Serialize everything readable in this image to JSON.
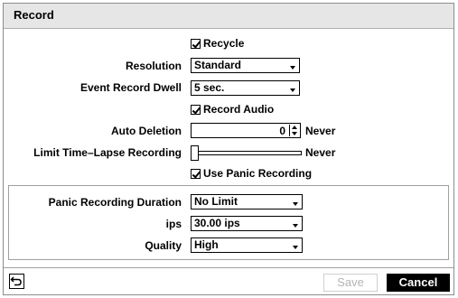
{
  "title": "Record",
  "recycle": {
    "label": "Recycle",
    "checked": true
  },
  "resolution": {
    "label": "Resolution",
    "value": "Standard"
  },
  "event_record_dwell": {
    "label": "Event Record Dwell",
    "value": "5 sec."
  },
  "record_audio": {
    "label": "Record Audio",
    "checked": true
  },
  "auto_deletion": {
    "label": "Auto Deletion",
    "value": "0",
    "unit_text": "Never"
  },
  "limit_time_lapse": {
    "label": "Limit Time–Lapse Recording",
    "value_text": "Never"
  },
  "use_panic_recording": {
    "label": "Use Panic Recording",
    "checked": true
  },
  "panic": {
    "duration": {
      "label": "Panic Recording Duration",
      "value": "No Limit"
    },
    "ips": {
      "label": "ips",
      "value": "30.00 ips"
    },
    "quality": {
      "label": "Quality",
      "value": "High"
    }
  },
  "footer": {
    "back_icon": "back-arrow-icon",
    "save_label": "Save",
    "cancel_label": "Cancel"
  }
}
